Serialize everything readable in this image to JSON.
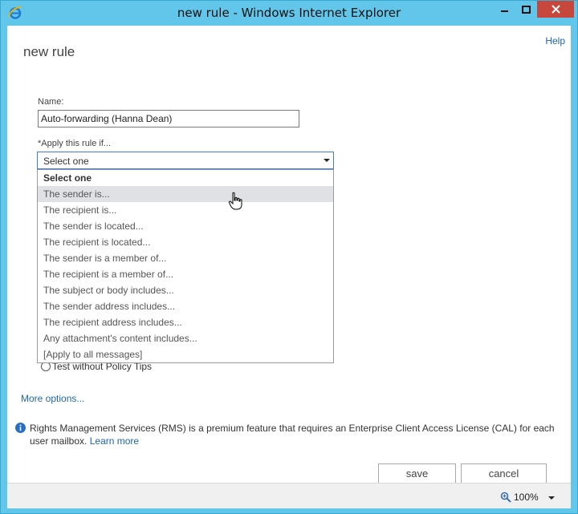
{
  "window": {
    "title": "new rule - Windows Internet Explorer",
    "icon": "internet-explorer-icon",
    "controls": [
      "minimize-icon",
      "maximize-icon",
      "close-icon"
    ]
  },
  "page": {
    "help": "Help",
    "title": "new rule"
  },
  "form": {
    "name_label": "Name:",
    "name_value": "Auto-forwarding (Hanna Dean)",
    "apply_label": "*Apply this rule if...",
    "apply_selected": "Select one",
    "apply_options": [
      "Select one",
      "The sender is...",
      "The recipient is...",
      "The sender is located...",
      "The recipient is located...",
      "The sender is a member of...",
      "The recipient is a member of...",
      "The subject or body includes...",
      "The sender address includes...",
      "The recipient address includes...",
      "Any attachment's content includes...",
      "[Apply to all messages]"
    ],
    "hovered_option": "The sender is...",
    "radio_label": "Test without Policy Tips",
    "more_options": "More options..."
  },
  "info": {
    "text": "Rights Management Services (RMS) is a premium feature that requires an Enterprise Client Access License (CAL) for each user mailbox.",
    "link": "Learn more"
  },
  "buttons": {
    "save": "save",
    "cancel": "cancel"
  },
  "status": {
    "zoom": "100%"
  },
  "colors": {
    "frame": "#61c6ea",
    "link": "#1e66b0",
    "close_button": "#c7473c",
    "select_border": "#3d7ed4"
  }
}
